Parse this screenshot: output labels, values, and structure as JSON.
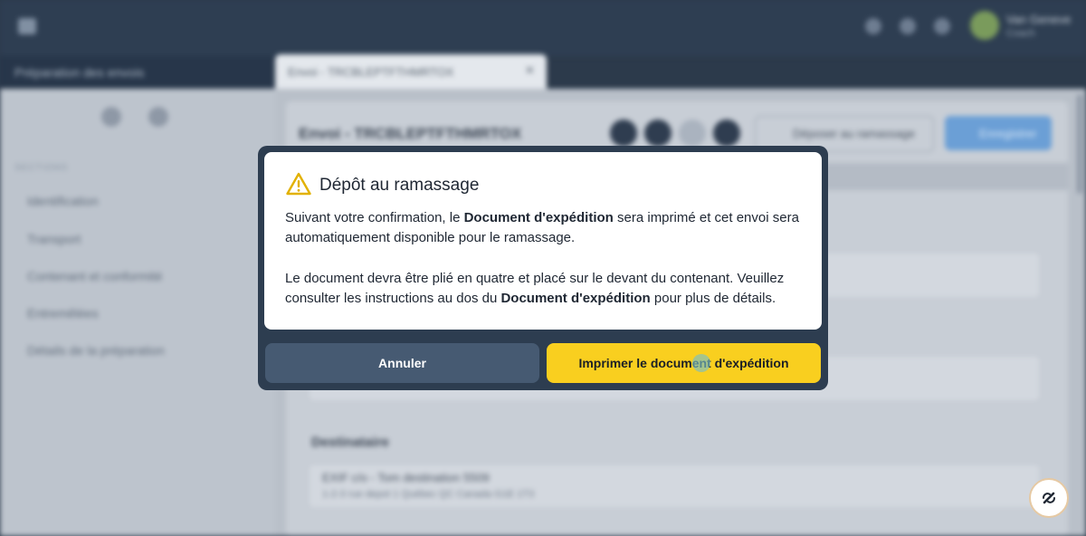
{
  "app": {
    "section_title": "Préparation des envois",
    "tab_label": "Envoi - TRCBLEPTFTHMRTOX",
    "tab_close": "✕",
    "user_name": "Van Geneve",
    "user_role": "Coach",
    "sidebar_heading": "SECTIONS",
    "sidebar_items": [
      "Identification",
      "Transport",
      "Contenant et conformité",
      "Entremêlées",
      "Détails de la préparation"
    ],
    "envoi_title": "Envoi - TRCBLEPTFTHMRTOX",
    "pickup_button": "Déposer au ramassage",
    "save_button": "Enregistrer",
    "destination_title": "Destinataire",
    "destination_line1": "EXIF c/o - Tom destination 5509",
    "destination_line2": "1-2-3 rue depot 1 Québec QC Canada G1E 1T3"
  },
  "modal": {
    "title": "Dépôt au ramassage",
    "para1_before": "Suivant votre confirmation, le ",
    "para1_bold": "Document d'expédition",
    "para1_after": " sera imprimé et cet envoi sera automatiquement disponible pour le ramassage.",
    "para2_before": "Le document devra être plié en quatre et placé sur le devant du contenant. Veuillez consulter les instructions au dos du ",
    "para2_bold": "Document d'expédition",
    "para2_after": " pour plus de détails.",
    "cancel_label": "Annuler",
    "print_label": "Imprimer le document d'expédition"
  },
  "colors": {
    "modal_frame": "#2d3d50",
    "cancel_button": "#465a72",
    "print_button": "#f9cf1f",
    "warning_icon": "#e2b100"
  },
  "icons": {
    "warning": "warning-triangle-icon",
    "help": "help-link-icon"
  }
}
